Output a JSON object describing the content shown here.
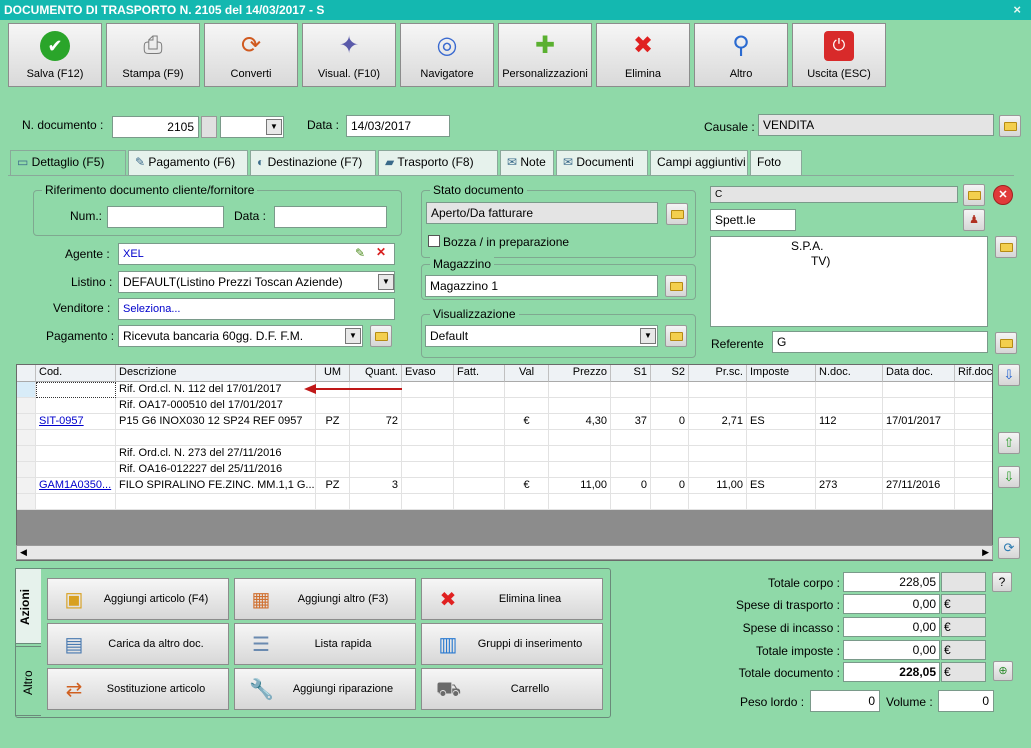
{
  "window": {
    "title": "DOCUMENTO DI TRASPORTO N. 2105 del 14/03/2017 - S",
    "close": "×"
  },
  "toolbar": [
    {
      "label": "Salva (F12)",
      "icon": "check-icon"
    },
    {
      "label": "Stampa (F9)",
      "icon": "printer-icon"
    },
    {
      "label": "Converti",
      "icon": "convert-icon"
    },
    {
      "label": "Visual. (F10)",
      "icon": "magic-wand-icon"
    },
    {
      "label": "Navigatore",
      "icon": "compass-icon"
    },
    {
      "label": "Personalizzazioni",
      "icon": "puzzle-icon"
    },
    {
      "label": "Elimina",
      "icon": "delete-x-icon"
    },
    {
      "label": "Altro",
      "icon": "magnifier-icon"
    },
    {
      "label": "Uscita (ESC)",
      "icon": "power-icon"
    }
  ],
  "header": {
    "ndoc_label": "N. documento :",
    "ndoc_value": "2105",
    "data_label": "Data :",
    "data_value": "14/03/2017",
    "causale_label": "Causale :",
    "causale_value": "VENDITA"
  },
  "tabs": [
    "Dettaglio (F5)",
    "Pagamento (F6)",
    "Destinazione (F7)",
    "Trasporto (F8)",
    "Note",
    "Documenti",
    "Campi aggiuntivi",
    "Foto"
  ],
  "rif": {
    "title": "Riferimento documento cliente/fornitore",
    "num_label": "Num.:",
    "data_label": "Data :"
  },
  "fields": {
    "agente_label": "Agente :",
    "agente_value": "XEL",
    "listino_label": "Listino :",
    "listino_value": "DEFAULT(Listino Prezzi Toscan Aziende)",
    "venditore_label": "Venditore :",
    "venditore_value": "Seleziona...",
    "pagamento_label": "Pagamento :",
    "pagamento_value": "Ricevuta bancaria 60gg. D.F. F.M."
  },
  "stato": {
    "title": "Stato documento",
    "value": "Aperto/Da fatturare",
    "bozza": "Bozza / in preparazione"
  },
  "magazzino": {
    "title": "Magazzino",
    "value": "Magazzino 1"
  },
  "visualizzazione": {
    "title": "Visualizzazione",
    "value": "Default"
  },
  "cliente": {
    "name": "C",
    "title": "Spett.le",
    "addr1": "S.P.A.",
    "addr2": "",
    "addr3": "TV)",
    "referente_label": "Referente",
    "referente_value": "G"
  },
  "grid": {
    "columns": [
      "Cod.",
      "Descrizione",
      "UM",
      "Quant.",
      "Evaso",
      "Fatt.",
      "Val",
      "Prezzo",
      "S1",
      "S2",
      "Pr.sc.",
      "Imposte",
      "N.doc.",
      "Data doc.",
      "Rif.doc"
    ],
    "rows": [
      [
        "",
        "Rif. Ord.cl. N. 112 del 17/01/2017",
        "",
        "",
        "",
        "",
        "",
        "",
        "",
        "",
        "",
        "",
        "",
        "",
        ""
      ],
      [
        "",
        "Rif. OA17-000510 del 17/01/2017",
        "",
        "",
        "",
        "",
        "",
        "",
        "",
        "",
        "",
        "",
        "",
        "",
        ""
      ],
      [
        "SIT-0957",
        "P15 G6 INOX030 12 SP24 REF 0957",
        "PZ",
        "72",
        "",
        "",
        "€",
        "4,30",
        "37",
        "0",
        "2,71",
        "ES",
        "112",
        "17/01/2017",
        ""
      ],
      [
        "",
        "",
        "",
        "",
        "",
        "",
        "",
        "",
        "",
        "",
        "",
        "",
        "",
        "",
        ""
      ],
      [
        "",
        "Rif. Ord.cl. N. 273 del 27/11/2016",
        "",
        "",
        "",
        "",
        "",
        "",
        "",
        "",
        "",
        "",
        "",
        "",
        ""
      ],
      [
        "",
        "Rif. OA16-012227 del 25/11/2016",
        "",
        "",
        "",
        "",
        "",
        "",
        "",
        "",
        "",
        "",
        "",
        "",
        ""
      ],
      [
        "GAM1A0350...",
        "FILO SPIRALINO FE.ZINC. MM.1,1 G....",
        "PZ",
        "3",
        "",
        "",
        "€",
        "11,00",
        "0",
        "0",
        "11,00",
        "ES",
        "273",
        "27/11/2016",
        ""
      ],
      [
        "",
        "",
        "",
        "",
        "",
        "",
        "",
        "",
        "",
        "",
        "",
        "",
        "",
        "",
        ""
      ]
    ]
  },
  "side_tabs": [
    "Azioni",
    "Altro"
  ],
  "actions": [
    {
      "label": "Aggiungi articolo (F4)",
      "icon": "box-add-icon"
    },
    {
      "label": "Aggiungi altro (F3)",
      "icon": "grid-add-icon"
    },
    {
      "label": "Elimina linea",
      "icon": "delete-x-icon"
    },
    {
      "label": "Carica da altro doc.",
      "icon": "doc-load-icon"
    },
    {
      "label": "Lista rapida",
      "icon": "list-add-icon"
    },
    {
      "label": "Gruppi di inserimento",
      "icon": "group-add-icon"
    },
    {
      "label": "Sostituzione articolo",
      "icon": "swap-icon"
    },
    {
      "label": "Aggiungi riparazione",
      "icon": "wrench-icon"
    },
    {
      "label": "Carrello",
      "icon": "cart-icon"
    }
  ],
  "totals": {
    "corpo_label": "Totale corpo :",
    "corpo_value": "228,05",
    "trasporto_label": "Spese di trasporto :",
    "trasporto_value": "0,00",
    "incasso_label": "Spese di incasso :",
    "incasso_value": "0,00",
    "imposte_label": "Totale imposte :",
    "imposte_value": "0,00",
    "documento_label": "Totale documento :",
    "documento_value": "228,05",
    "currency": "€",
    "peso_label": "Peso lordo :",
    "peso_value": "0",
    "volume_label": "Volume :",
    "volume_value": "0",
    "help": "?"
  }
}
